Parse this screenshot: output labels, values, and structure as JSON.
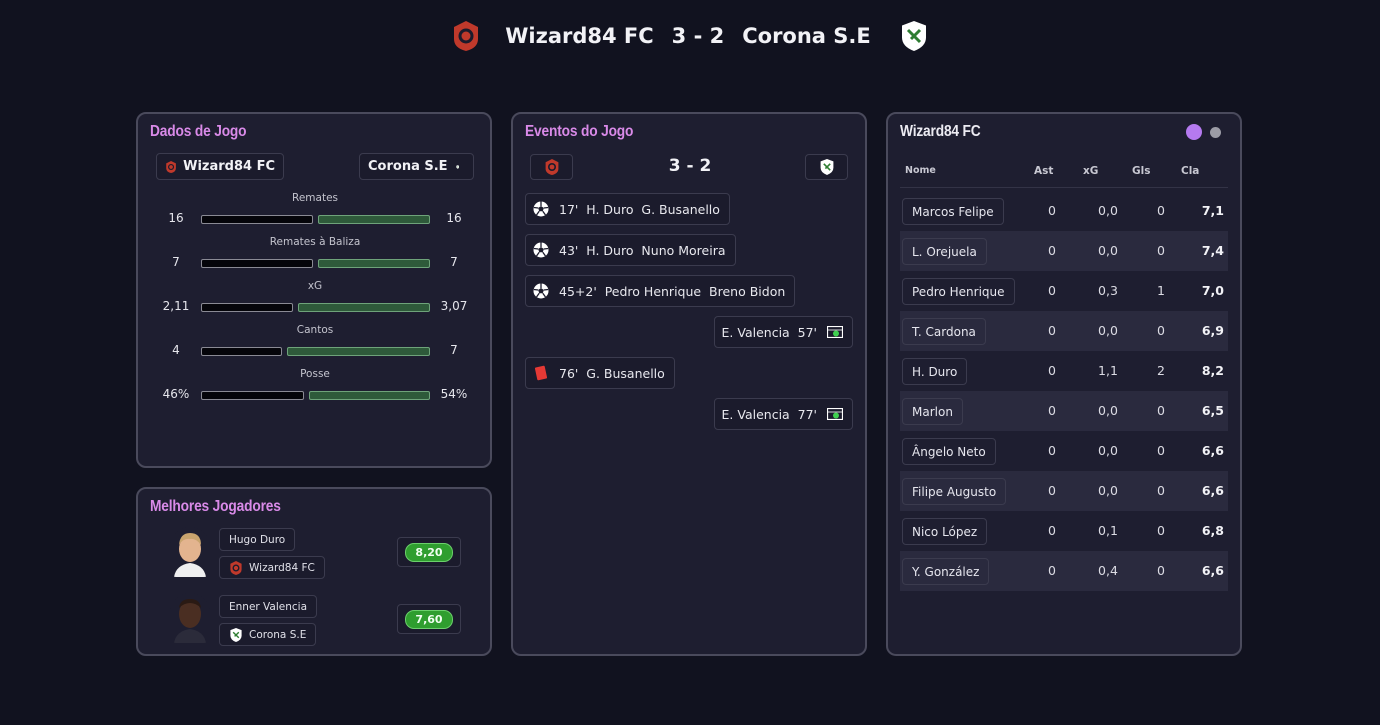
{
  "header": {
    "home": "Wizard84 FC",
    "score": "3 - 2",
    "away": "Corona S.E"
  },
  "colors": {
    "accent_title": "#d98ae8",
    "rating_green": "#2f9e2f",
    "bar_right": "#2e5a3a",
    "home_crest": "#c0392b",
    "away_crest": "#ffffff"
  },
  "stats": {
    "title": "Dados de Jogo",
    "home_team": "Wizard84 FC",
    "away_team": "Corona S.E",
    "rows": [
      {
        "label": "Remates",
        "home": "16",
        "away": "16",
        "home_share": 0.5
      },
      {
        "label": "Remates à Baliza",
        "home": "7",
        "away": "7",
        "home_share": 0.5
      },
      {
        "label": "xG",
        "home": "2,11",
        "away": "3,07",
        "home_share": 0.41
      },
      {
        "label": "Cantos",
        "home": "4",
        "away": "7",
        "home_share": 0.36
      },
      {
        "label": "Posse",
        "home": "46%",
        "away": "54%",
        "home_share": 0.46
      }
    ]
  },
  "best": {
    "title": "Melhores Jogadores",
    "players": [
      {
        "name": "Hugo Duro",
        "team": "Wizard84 FC",
        "rating": "8,20"
      },
      {
        "name": "Enner Valencia",
        "team": "Corona S.E",
        "rating": "7,60"
      }
    ]
  },
  "events": {
    "title": "Eventos do Jogo",
    "score": "3 - 2",
    "items": [
      {
        "side": "home",
        "icon": "football-icon",
        "text": "17'  H. Duro  G. Busanello"
      },
      {
        "side": "home",
        "icon": "football-icon",
        "text": "43'  H. Duro  Nuno Moreira"
      },
      {
        "side": "home",
        "icon": "football-icon",
        "text": "45+2'  Pedro Henrique  Breno Bidon"
      },
      {
        "side": "away",
        "icon": "goal-icon",
        "text": "E. Valencia  57'"
      },
      {
        "side": "home",
        "icon": "red-card-icon",
        "text": "76'  G. Busanello"
      },
      {
        "side": "away",
        "icon": "goal-icon",
        "text": "E. Valencia  77'"
      }
    ]
  },
  "players": {
    "title": "Wizard84 FC",
    "headers": {
      "name": "Nome",
      "ast": "Ast",
      "xg": "xG",
      "gls": "Gls",
      "cla": "Cla"
    },
    "rows": [
      {
        "name": "Marcos Felipe",
        "ast": "0",
        "xg": "0,0",
        "gls": "0",
        "cla": "7,1"
      },
      {
        "name": "L. Orejuela",
        "ast": "0",
        "xg": "0,0",
        "gls": "0",
        "cla": "7,4"
      },
      {
        "name": "Pedro Henrique",
        "ast": "0",
        "xg": "0,3",
        "gls": "1",
        "cla": "7,0"
      },
      {
        "name": "T. Cardona",
        "ast": "0",
        "xg": "0,0",
        "gls": "0",
        "cla": "6,9"
      },
      {
        "name": "H. Duro",
        "ast": "0",
        "xg": "1,1",
        "gls": "2",
        "cla": "8,2"
      },
      {
        "name": "Marlon",
        "ast": "0",
        "xg": "0,0",
        "gls": "0",
        "cla": "6,5"
      },
      {
        "name": "Ângelo Neto",
        "ast": "0",
        "xg": "0,0",
        "gls": "0",
        "cla": "6,6"
      },
      {
        "name": "Filipe Augusto",
        "ast": "0",
        "xg": "0,0",
        "gls": "0",
        "cla": "6,6"
      },
      {
        "name": "Nico López",
        "ast": "0",
        "xg": "0,1",
        "gls": "0",
        "cla": "6,8"
      },
      {
        "name": "Y. González",
        "ast": "0",
        "xg": "0,4",
        "gls": "0",
        "cla": "6,6"
      }
    ]
  }
}
